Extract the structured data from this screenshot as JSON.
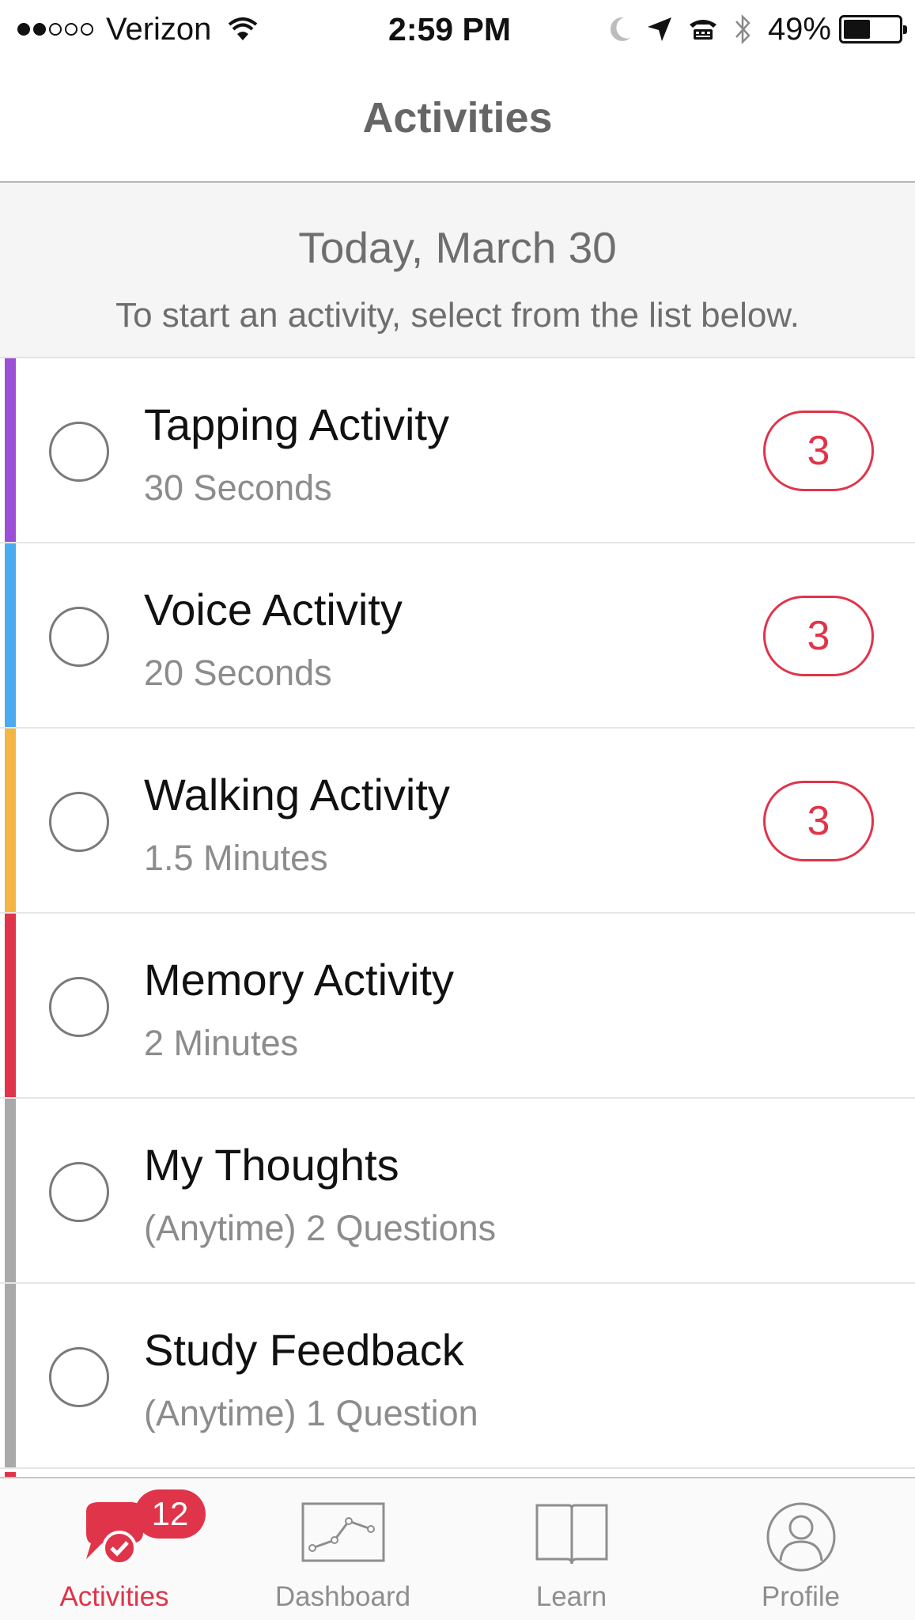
{
  "status_bar": {
    "carrier": "Verizon",
    "signal_bars_filled": 2,
    "signal_bars_total": 5,
    "time": "2:59 PM",
    "battery_percent": "49%",
    "battery_level": 0.49,
    "icons": [
      "wifi-icon",
      "moon-icon",
      "location-arrow-icon",
      "tty-icon",
      "bluetooth-icon",
      "battery-icon"
    ]
  },
  "nav": {
    "title": "Activities"
  },
  "header": {
    "date": "Today, March 30",
    "instructions": "To start an activity, select from the list below."
  },
  "activities": [
    {
      "name": "Tapping Activity",
      "subtitle": "30 Seconds",
      "count": "3",
      "color": "#9b4fd6"
    },
    {
      "name": "Voice Activity",
      "subtitle": "20 Seconds",
      "count": "3",
      "color": "#4aabf0"
    },
    {
      "name": "Walking Activity",
      "subtitle": "1.5 Minutes",
      "count": "3",
      "color": "#f5b544"
    },
    {
      "name": "Memory Activity",
      "subtitle": "2 Minutes",
      "count": null,
      "color": "#e0344a"
    },
    {
      "name": "My Thoughts",
      "subtitle": "(Anytime) 2 Questions",
      "count": null,
      "color": "#a9a9a9"
    },
    {
      "name": "Study Feedback",
      "subtitle": "(Anytime) 1 Question",
      "count": null,
      "color": "#a9a9a9"
    }
  ],
  "tab_bar": {
    "tabs": [
      {
        "label": "Activities",
        "icon": "chat-bubble-check-icon",
        "badge": "12",
        "active": true
      },
      {
        "label": "Dashboard",
        "icon": "line-chart-icon",
        "active": false
      },
      {
        "label": "Learn",
        "icon": "open-book-icon",
        "active": false
      },
      {
        "label": "Profile",
        "icon": "person-circle-icon",
        "active": false
      }
    ]
  },
  "colors": {
    "accent": "#e0344a",
    "title_gray": "#666666",
    "secondary_text": "#8c8c8c",
    "header_bg": "#f5f5f5"
  }
}
